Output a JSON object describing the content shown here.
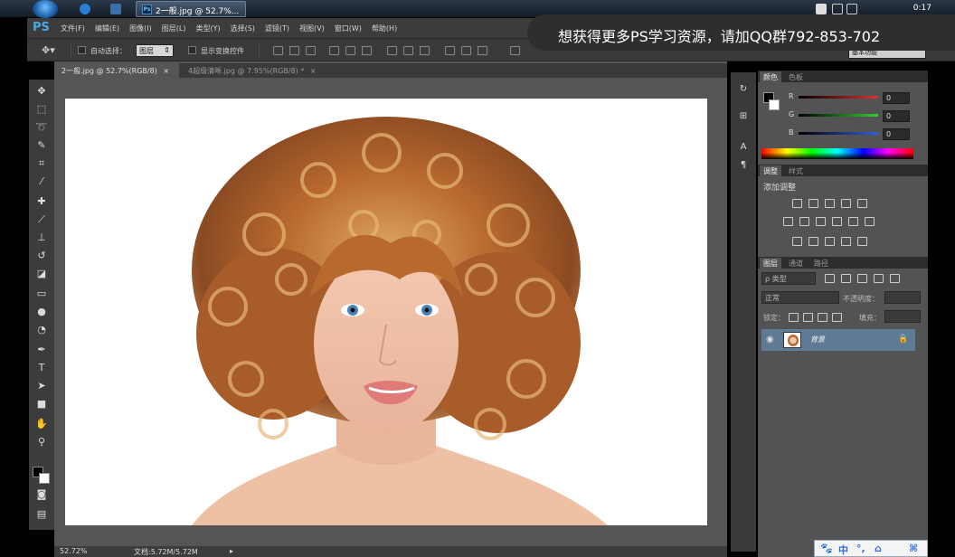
{
  "taskbar": {
    "ps_task_label": "2一般.jpg @ 52.7%...",
    "clock": "0:17"
  },
  "ad_overlay": {
    "text": "想获得更多PS学习资源，请加QQ群792-853-702"
  },
  "app": {
    "logo": "PS",
    "menu": [
      "文件(F)",
      "编辑(E)",
      "图像(I)",
      "图层(L)",
      "类型(Y)",
      "选择(S)",
      "滤镜(T)",
      "视图(V)",
      "窗口(W)",
      "帮助(H)"
    ]
  },
  "options_bar": {
    "auto_select_label": "自动选择：",
    "auto_select_value": "图层",
    "show_transform_label": "显示变换控件",
    "workspace": "基本功能"
  },
  "document_tabs": [
    {
      "label": "2一般.jpg @ 52.7%(RGB/8)",
      "active": true,
      "close": "×"
    },
    {
      "label": "4超级清晰.jpg @ 7.95%(RGB/8) *",
      "active": false,
      "close": "×"
    }
  ],
  "status_bar": {
    "zoom": "52.72%",
    "doc_info": "文档:5.72M/5.72M"
  },
  "panels": {
    "color": {
      "tabs": [
        "颜色",
        "色板"
      ],
      "channels": [
        {
          "label": "R",
          "value": "0",
          "color": "#e03030"
        },
        {
          "label": "G",
          "value": "0",
          "color": "#30d030"
        },
        {
          "label": "B",
          "value": "0",
          "color": "#3060e0"
        }
      ]
    },
    "adjustments": {
      "tabs": [
        "调整",
        "样式"
      ],
      "title": "添加调整"
    },
    "layers": {
      "tabs": [
        "图层",
        "通道",
        "路径"
      ],
      "kind_filter": "ρ 类型",
      "blend_mode": "正常",
      "opacity_label": "不透明度：",
      "lock_label": "锁定：",
      "fill_label": "填充：",
      "layer_name": "背景"
    }
  },
  "ime": {
    "items": [
      "中",
      "°,",
      "⌂",
      "⌘"
    ]
  },
  "colors": {
    "ps_dark": "#3c3c3c",
    "panel_bg": "#535353",
    "layer_selected": "#5f7a94",
    "canvas_area": "#555555"
  }
}
